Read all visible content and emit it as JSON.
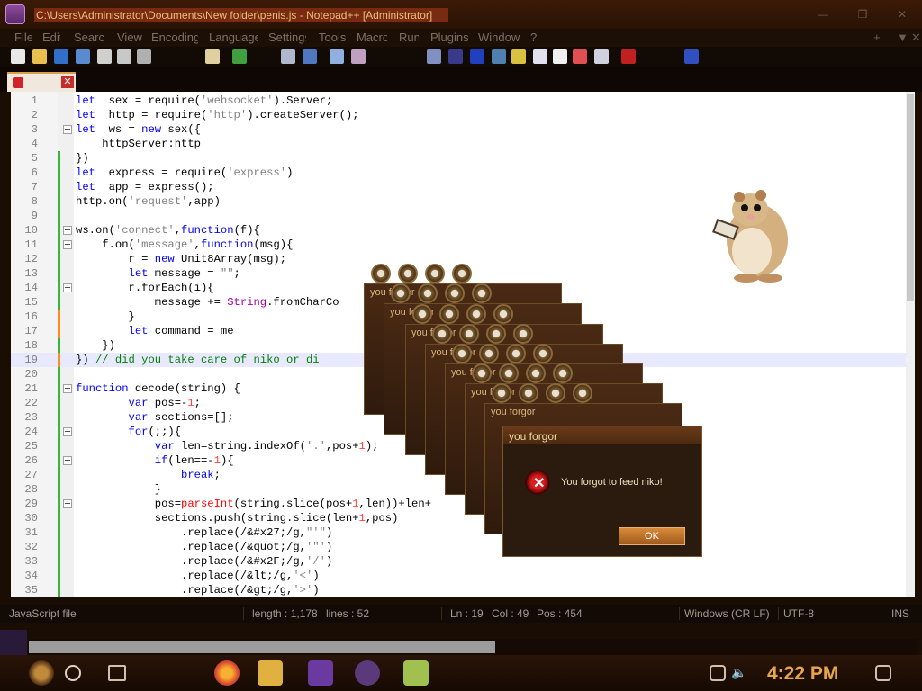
{
  "window": {
    "title": "C:\\Users\\Administrator\\Documents\\New folder\\penis.js - Notepad++ [Administrator]",
    "controls": [
      "—",
      "❐",
      "✕"
    ]
  },
  "menu": {
    "items": [
      "File",
      "Edit",
      "Search",
      "View",
      "Encoding",
      "Language",
      "Settings",
      "Tools",
      "Macro",
      "Run",
      "Plugins",
      "Window",
      "?"
    ],
    "right": [
      "+",
      "▼",
      "✕"
    ]
  },
  "tab": {
    "close": "✕"
  },
  "editor": {
    "current_line": 19,
    "lines": [
      {
        "n": "1",
        "code": [
          [
            "kw",
            "let"
          ],
          [
            "",
            "  sex = require("
          ],
          [
            "str",
            "'websocket'"
          ],
          [
            "",
            ").Server;"
          ]
        ]
      },
      {
        "n": "2",
        "code": [
          [
            "kw",
            "let"
          ],
          [
            "",
            "  http = require("
          ],
          [
            "str",
            "'http'"
          ],
          [
            "",
            ").createServer();"
          ]
        ]
      },
      {
        "n": "3",
        "code": [
          [
            "kw",
            "let"
          ],
          [
            "",
            "  ws = "
          ],
          [
            "kw",
            "new"
          ],
          [
            "",
            " sex({"
          ]
        ]
      },
      {
        "n": "4",
        "code": [
          [
            "",
            "    httpServer:http"
          ]
        ]
      },
      {
        "n": "5",
        "code": [
          [
            "",
            "})"
          ]
        ]
      },
      {
        "n": "6",
        "code": [
          [
            "kw",
            "let"
          ],
          [
            "",
            "  express = require("
          ],
          [
            "str",
            "'express'"
          ],
          [
            "",
            ")"
          ]
        ]
      },
      {
        "n": "7",
        "code": [
          [
            "kw",
            "let"
          ],
          [
            "",
            "  app = express();"
          ]
        ]
      },
      {
        "n": "8",
        "code": [
          [
            "",
            "http.on("
          ],
          [
            "str",
            "'request'"
          ],
          [
            "",
            ",app)"
          ]
        ]
      },
      {
        "n": "9",
        "code": []
      },
      {
        "n": "10",
        "code": [
          [
            "",
            "ws.on("
          ],
          [
            "str",
            "'connect'"
          ],
          [
            "",
            ","
          ],
          [
            "kw",
            "function"
          ],
          [
            "",
            "(f){"
          ]
        ]
      },
      {
        "n": "11",
        "code": [
          [
            "",
            "    f.on("
          ],
          [
            "str",
            "'message'"
          ],
          [
            "",
            ","
          ],
          [
            "kw",
            "function"
          ],
          [
            "",
            "(msg){"
          ]
        ]
      },
      {
        "n": "12",
        "code": [
          [
            "",
            "        r = "
          ],
          [
            "kw",
            "new"
          ],
          [
            "",
            " Unit8Array(msg);"
          ]
        ]
      },
      {
        "n": "13",
        "code": [
          [
            "kw",
            "        let"
          ],
          [
            "",
            " message = "
          ],
          [
            "str",
            "\"\""
          ],
          [
            "",
            ";"
          ]
        ]
      },
      {
        "n": "14",
        "code": [
          [
            "",
            "        r.forEach(i){"
          ]
        ]
      },
      {
        "n": "15",
        "code": [
          [
            "",
            "            message += "
          ],
          [
            "builtin",
            "String"
          ],
          [
            "",
            ".fromCharCo"
          ]
        ]
      },
      {
        "n": "16",
        "code": [
          [
            "",
            "        }"
          ]
        ]
      },
      {
        "n": "17",
        "code": [
          [
            "kw",
            "        let"
          ],
          [
            "",
            " command = me"
          ]
        ]
      },
      {
        "n": "18",
        "code": [
          [
            "",
            "    })"
          ]
        ]
      },
      {
        "n": "19",
        "code": [
          [
            "",
            "}) "
          ],
          [
            "cm",
            "// did you take care of niko or di"
          ]
        ]
      },
      {
        "n": "20",
        "code": []
      },
      {
        "n": "21",
        "code": [
          [
            "kw",
            "function"
          ],
          [
            "",
            " decode(string) {"
          ]
        ]
      },
      {
        "n": "22",
        "code": [
          [
            "kw",
            "        var"
          ],
          [
            "",
            " pos=-"
          ],
          [
            "num",
            "1"
          ],
          [
            "",
            ";"
          ]
        ]
      },
      {
        "n": "23",
        "code": [
          [
            "kw",
            "        var"
          ],
          [
            "",
            " sections=[];"
          ]
        ]
      },
      {
        "n": "24",
        "code": [
          [
            "kw",
            "        for"
          ],
          [
            "",
            "(;;){"
          ]
        ]
      },
      {
        "n": "25",
        "code": [
          [
            "kw",
            "            var"
          ],
          [
            "",
            " len=string.indexOf("
          ],
          [
            "str",
            "'.'"
          ],
          [
            "",
            ",pos+"
          ],
          [
            "num",
            "1"
          ],
          [
            "",
            ");"
          ]
        ]
      },
      {
        "n": "26",
        "code": [
          [
            "kw",
            "            if"
          ],
          [
            "",
            "(len==-"
          ],
          [
            "num",
            "1"
          ],
          [
            "",
            "){"
          ]
        ]
      },
      {
        "n": "27",
        "code": [
          [
            "kw",
            "                break"
          ],
          [
            "",
            ";"
          ]
        ]
      },
      {
        "n": "28",
        "code": [
          [
            "",
            "            }"
          ]
        ]
      },
      {
        "n": "29",
        "code": [
          [
            "",
            "            pos="
          ],
          [
            "fn",
            "parseInt"
          ],
          [
            "",
            "(string.slice(pos+"
          ],
          [
            "num",
            "1"
          ],
          [
            "",
            ",len))+len+"
          ]
        ]
      },
      {
        "n": "30",
        "code": [
          [
            "",
            "            sections.push(string.slice(len+"
          ],
          [
            "num",
            "1"
          ],
          [
            "",
            ",pos)"
          ]
        ]
      },
      {
        "n": "31",
        "code": [
          [
            "",
            "                .replace(/&#x27;/g,"
          ],
          [
            "str",
            "\"'\""
          ],
          [
            "",
            ")"
          ]
        ]
      },
      {
        "n": "32",
        "code": [
          [
            "",
            "                .replace(/&quot;/g,"
          ],
          [
            "str",
            "'\"'"
          ],
          [
            "",
            ")"
          ]
        ]
      },
      {
        "n": "33",
        "code": [
          [
            "",
            "                .replace(/&#x2F;/g,"
          ],
          [
            "str",
            "'/'"
          ],
          [
            "",
            ")"
          ]
        ]
      },
      {
        "n": "34",
        "code": [
          [
            "",
            "                .replace(/&lt;/g,"
          ],
          [
            "str",
            "'<'"
          ],
          [
            "",
            ")"
          ]
        ]
      },
      {
        "n": "35",
        "code": [
          [
            "",
            "                .replace(/&gt;/g,"
          ],
          [
            "str",
            "'>'"
          ],
          [
            "",
            ")"
          ]
        ]
      }
    ]
  },
  "status": {
    "file_type": "JavaScript file",
    "length": "length : 1,178",
    "lines": "lines : 52",
    "ln": "Ln : 19",
    "col": "Col : 49",
    "pos": "Pos : 454",
    "eol": "Windows (CR LF)",
    "encoding": "UTF-8",
    "mode": "INS"
  },
  "dialog": {
    "title": "you forgor",
    "message": "You forgot to feed niko!",
    "ok_label": "OK",
    "stack_title": "you forgor"
  },
  "taskbar": {
    "clock": "4:22 PM"
  }
}
